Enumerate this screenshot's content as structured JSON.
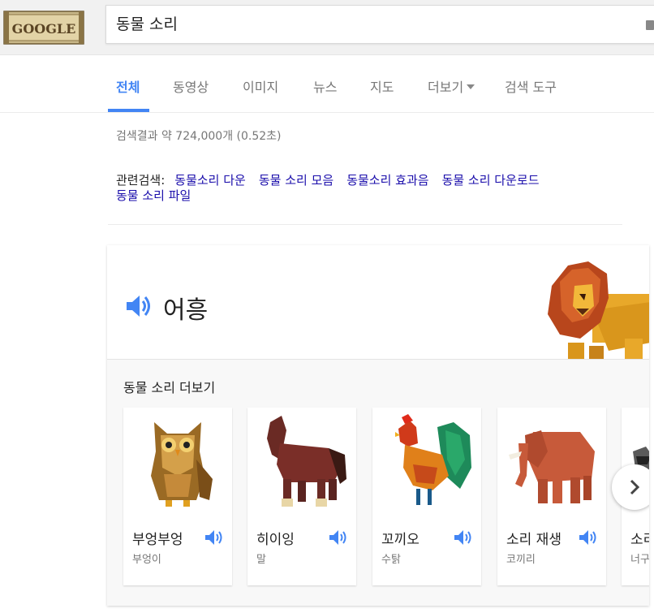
{
  "search": {
    "query": "동물 소리",
    "logo_text": "GOOGLE"
  },
  "tabs": [
    {
      "label": "전체",
      "active": true
    },
    {
      "label": "동영상"
    },
    {
      "label": "이미지"
    },
    {
      "label": "뉴스"
    },
    {
      "label": "지도"
    },
    {
      "label": "더보기"
    },
    {
      "label": "검색 도구"
    }
  ],
  "results": {
    "stats": "검색결과 약 724,000개 (0.52초)",
    "related_label": "관련검색:",
    "related": [
      "동물소리 다운",
      "동물 소리 모음",
      "동물소리 효과음",
      "동물 소리 다운로드",
      "동물 소리 파일"
    ]
  },
  "card": {
    "sound_word": "어흥",
    "more_title": "동물 소리 더보기",
    "animals": [
      {
        "name": "부엉부엉",
        "animal": "부엉이"
      },
      {
        "name": "히이잉",
        "animal": "말"
      },
      {
        "name": "꼬끼오",
        "animal": "수탉"
      },
      {
        "name": "소리 재생",
        "animal": "코끼리"
      },
      {
        "name": "소리",
        "animal": "너구"
      }
    ]
  },
  "colors": {
    "accent": "#4285f4",
    "link": "#1a0dab"
  },
  "icons": {
    "speaker": "speaker-icon",
    "next": "chevron-right-icon",
    "caret": "caret-down-icon"
  }
}
